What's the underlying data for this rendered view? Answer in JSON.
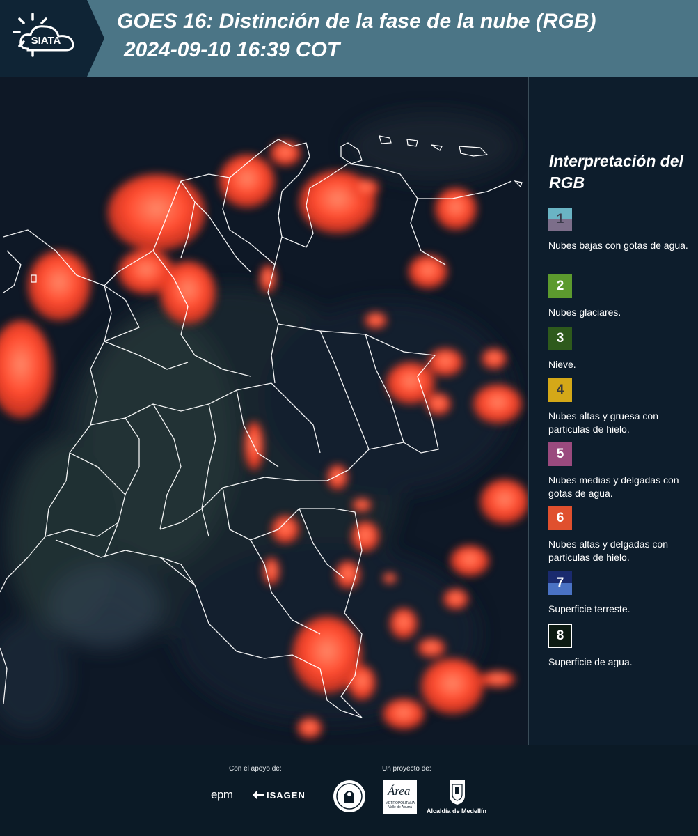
{
  "header": {
    "logo_text": "SIATA",
    "title_line1": "GOES 16: Distinción de la fase de la nube (RGB)",
    "title_line2": "2024-09-10 16:39 COT"
  },
  "legend": {
    "title": "Interpretación del RGB",
    "items": [
      {
        "number": "1",
        "label": "Nubes bajas con gotas de agua.",
        "color_top": "#6ab4c4",
        "color_bottom": "#7c6e8a",
        "number_color": "#3a3a4a"
      },
      {
        "number": "2",
        "label": "Nubes glaciares.",
        "color_top": "#5c9a2e",
        "color_bottom": "#5c9a2e",
        "number_color": "#ffffff"
      },
      {
        "number": "3",
        "label": "Nieve.",
        "color_top": "#2e5a1c",
        "color_bottom": "#2e5a1c",
        "number_color": "#ffffff"
      },
      {
        "number": "4",
        "label": "Nubes altas y gruesa con particulas de hielo.",
        "color_top": "#d4a818",
        "color_bottom": "#d4a818",
        "number_color": "#3a3a3a"
      },
      {
        "number": "5",
        "label": "Nubes medias y delgadas con gotas de agua.",
        "color_top": "#9a4a7e",
        "color_bottom": "#9a4a7e",
        "number_color": "#ffffff"
      },
      {
        "number": "6",
        "label": "Nubes altas y delgadas con particulas de hielo.",
        "color_top": "#e0502e",
        "color_bottom": "#e0502e",
        "number_color": "#ffffff"
      },
      {
        "number": "7",
        "label": "Superficie terreste.",
        "color_top": "#1a2a6e",
        "color_bottom": "#4a72c4",
        "number_color": "#ffffff"
      },
      {
        "number": "8",
        "label": "Superficie de agua.",
        "color_top": "#0c1a12",
        "color_bottom": "#0c1a12",
        "number_color": "#ffffff"
      }
    ]
  },
  "footer": {
    "support_caption": "Con el apoyo de:",
    "project_caption": "Un proyecto de:",
    "sponsor_epm": "epm",
    "sponsor_isagen": "ISAGEN",
    "partner_area": "Área",
    "partner_area_subtitle": "METROPOLITANA Valle de Aburrá",
    "partner_alcaldia": "Alcaldía de Medellín"
  },
  "colors": {
    "header_bg": "#4b7586",
    "logo_bg": "#0f2435",
    "panel_bg": "#0d1d2c",
    "cloud_red": "#ff4a2e"
  }
}
